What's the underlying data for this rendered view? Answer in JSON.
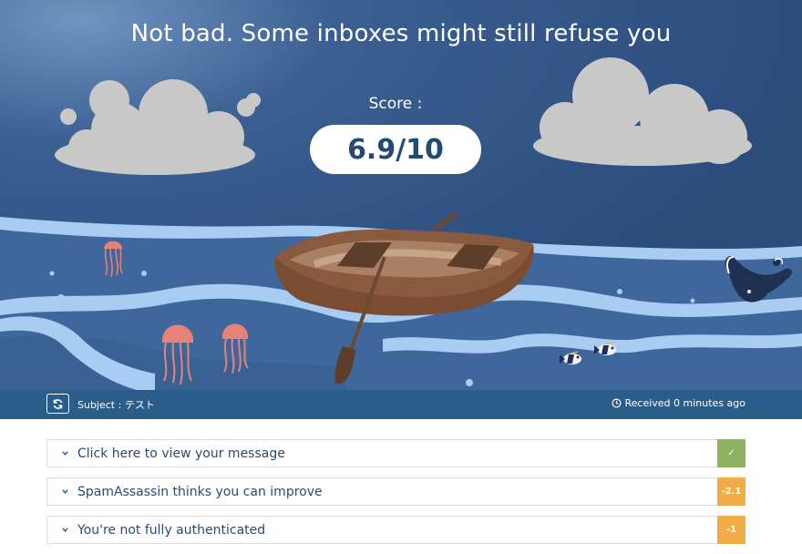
{
  "hero": {
    "headline": "Not bad. Some inboxes might still refuse you",
    "score_label": "Score :",
    "score_value": "6.9/10"
  },
  "subject_bar": {
    "refresh_icon": "refresh-icon",
    "subject": "Subject : テスト",
    "received": "Received 0 minutes ago",
    "received_icon": "clock-icon"
  },
  "results": [
    {
      "label": "Click here to view your message",
      "badge": "✓",
      "badge_color": "#8db262"
    },
    {
      "label": "SpamAssassin thinks you can improve",
      "badge": "-2.1",
      "badge_color": "#f0ac45"
    },
    {
      "label": "You're not fully authenticated",
      "badge": "-1",
      "badge_color": "#f0ac45"
    }
  ],
  "colors": {
    "sky": "#2e4f80",
    "sea": "#3e669b",
    "bar": "#2b5d8b",
    "score_text": "#234a73"
  }
}
